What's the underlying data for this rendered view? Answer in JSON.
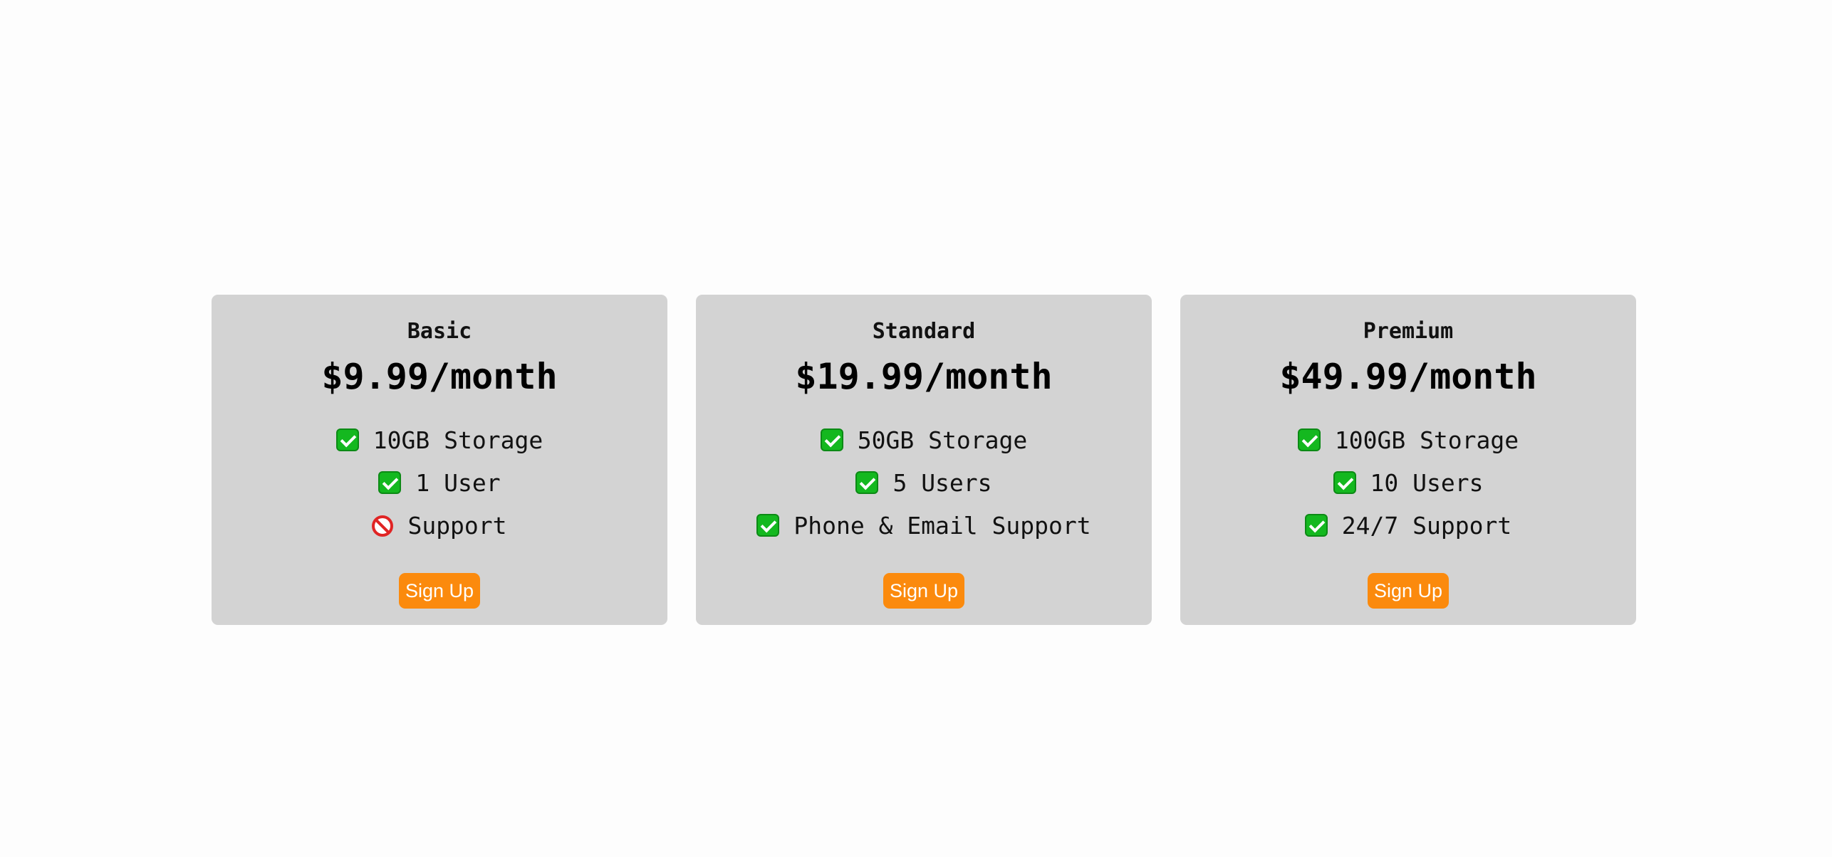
{
  "colors": {
    "page_background": "#fdfdfd",
    "card_background": "#d3d3d3",
    "button_background": "#fb8a0d",
    "button_text": "#ffffff",
    "check_green": "#14b81f",
    "prohibited_red": "#e02424"
  },
  "plans": [
    {
      "name": "Basic",
      "price": "$9.99/month",
      "features": [
        {
          "icon": "check-mark-icon",
          "text": "10GB Storage"
        },
        {
          "icon": "check-mark-icon",
          "text": "1 User"
        },
        {
          "icon": "prohibited-icon",
          "text": "Support"
        }
      ],
      "button_label": "Sign Up"
    },
    {
      "name": "Standard",
      "price": "$19.99/month",
      "features": [
        {
          "icon": "check-mark-icon",
          "text": "50GB Storage"
        },
        {
          "icon": "check-mark-icon",
          "text": "5 Users"
        },
        {
          "icon": "check-mark-icon",
          "text": "Phone & Email Support"
        }
      ],
      "button_label": "Sign Up"
    },
    {
      "name": "Premium",
      "price": "$49.99/month",
      "features": [
        {
          "icon": "check-mark-icon",
          "text": "100GB Storage"
        },
        {
          "icon": "check-mark-icon",
          "text": "10 Users"
        },
        {
          "icon": "check-mark-icon",
          "text": "24/7 Support"
        }
      ],
      "button_label": "Sign Up"
    }
  ]
}
